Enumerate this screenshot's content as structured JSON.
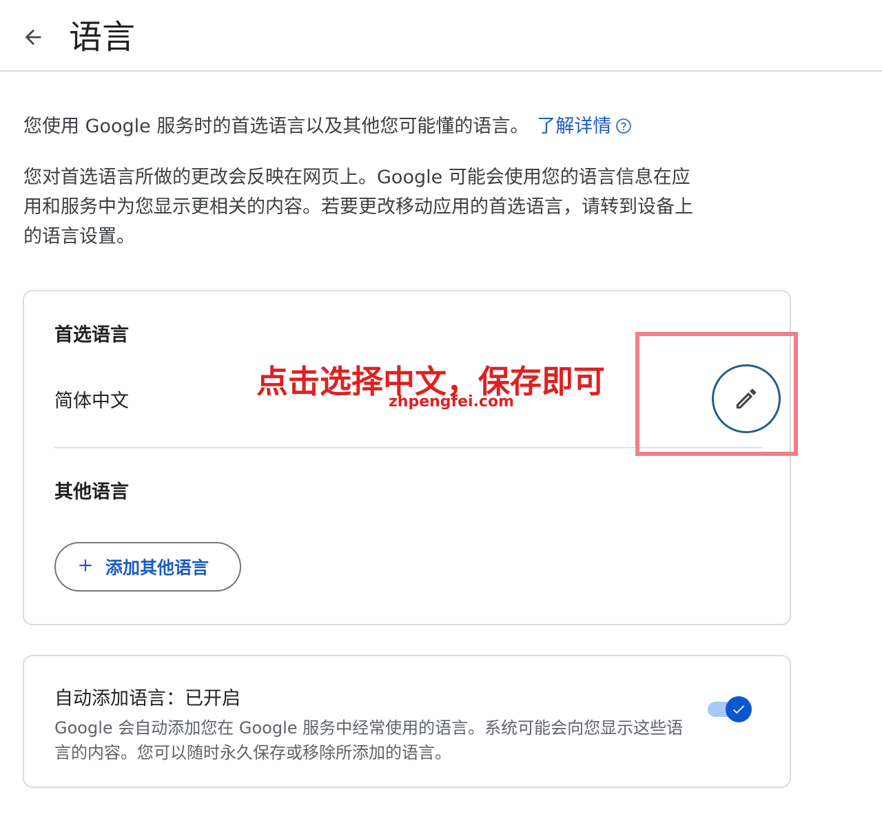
{
  "header": {
    "back_icon": "arrow-back-icon",
    "title": "语言"
  },
  "intro": {
    "text": "您使用 Google 服务时的首选语言以及其他您可能懂的语言。",
    "learn_more": "了解详情",
    "help_icon": "help-circle-icon"
  },
  "description": "您对首选语言所做的更改会反映在网页上。Google 可能会使用您的语言信息在应用和服务中为您显示更相关的内容。若要更改移动应用的首选语言，请转到设备上的语言设置。",
  "languages_card": {
    "preferred_title": "首选语言",
    "preferred_value": "简体中文",
    "edit_icon": "pencil-icon",
    "other_title": "其他语言",
    "add_button_label": "添加其他语言",
    "add_icon": "plus-icon"
  },
  "auto_add_card": {
    "title": "自动添加语言：已开启",
    "description": "Google 会自动添加您在 Google 服务中经常使用的语言。系统可能会向您显示这些语言的内容。您可以随时永久保存或移除所添加的语言。",
    "toggle_on": true
  },
  "annotation": {
    "text": "点击选择中文，保存即可",
    "watermark": "zhpengfei.com"
  },
  "colors": {
    "accent": "#1a5cbf",
    "annotation_red": "#e02020",
    "annotation_box": "#f07f87",
    "edit_ring": "#1f5f8b",
    "toggle_thumb": "#0b57d0",
    "toggle_track": "#a8c7fa"
  }
}
